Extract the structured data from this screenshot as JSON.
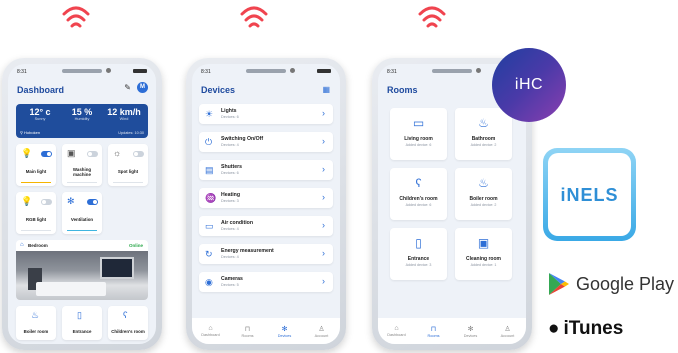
{
  "colors": {
    "accent": "#2d6ed6",
    "title": "#1e4a9e",
    "wifi": "#f0444f",
    "badge": "#5a3aa8",
    "online": "#2aa84a"
  },
  "status_time": "8:31",
  "dashboard": {
    "title": "Dashboard",
    "avatar_initial": "M",
    "weather": {
      "temp": "12° c",
      "temp_label": "Sunny",
      "humidity": "15 %",
      "humidity_label": "Humidity",
      "wind": "12 km/h",
      "wind_label": "Wind",
      "location": "Hoboken",
      "updated": "Updates: 10:30"
    },
    "tiles": [
      "Main light",
      "Washing machine",
      "Spot light",
      "RGB light",
      "Ventilation"
    ],
    "room": {
      "name": "Bedroom",
      "status": "Online"
    },
    "bottom_tiles": [
      "Boiler room",
      "Entrance",
      "Children's room"
    ]
  },
  "devices": {
    "title": "Devices",
    "items": [
      {
        "name": "Lights",
        "sub": "Devices: 6",
        "icon": "bulb-icon"
      },
      {
        "name": "Switching On/Off",
        "sub": "Devices: 4",
        "icon": "power-icon"
      },
      {
        "name": "Shutters",
        "sub": "Devices: 6",
        "icon": "shutters-icon"
      },
      {
        "name": "Heating",
        "sub": "Devices: 3",
        "icon": "heating-icon"
      },
      {
        "name": "Air condition",
        "sub": "Devices: 4",
        "icon": "ac-icon"
      },
      {
        "name": "Energy measurement",
        "sub": "Devices: 4",
        "icon": "energy-icon"
      },
      {
        "name": "Cameras",
        "sub": "Devices: 5",
        "icon": "camera-icon"
      }
    ]
  },
  "rooms": {
    "title": "Rooms",
    "items": [
      {
        "name": "Living room",
        "sub": "Added device: 6"
      },
      {
        "name": "Bathroom",
        "sub": "Added device: 2"
      },
      {
        "name": "Children's room",
        "sub": "Added device: 6"
      },
      {
        "name": "Boiler room",
        "sub": "Added device: 2"
      },
      {
        "name": "Entrance",
        "sub": "Added device: 3"
      },
      {
        "name": "Cleaning room",
        "sub": "Added device: 1"
      }
    ]
  },
  "nav": [
    "Dashboard",
    "Rooms",
    "Devices",
    "Account"
  ],
  "badge": "iHC",
  "app_brand": "iNELS",
  "store_google": "Google Play",
  "store_itunes": "iTunes"
}
